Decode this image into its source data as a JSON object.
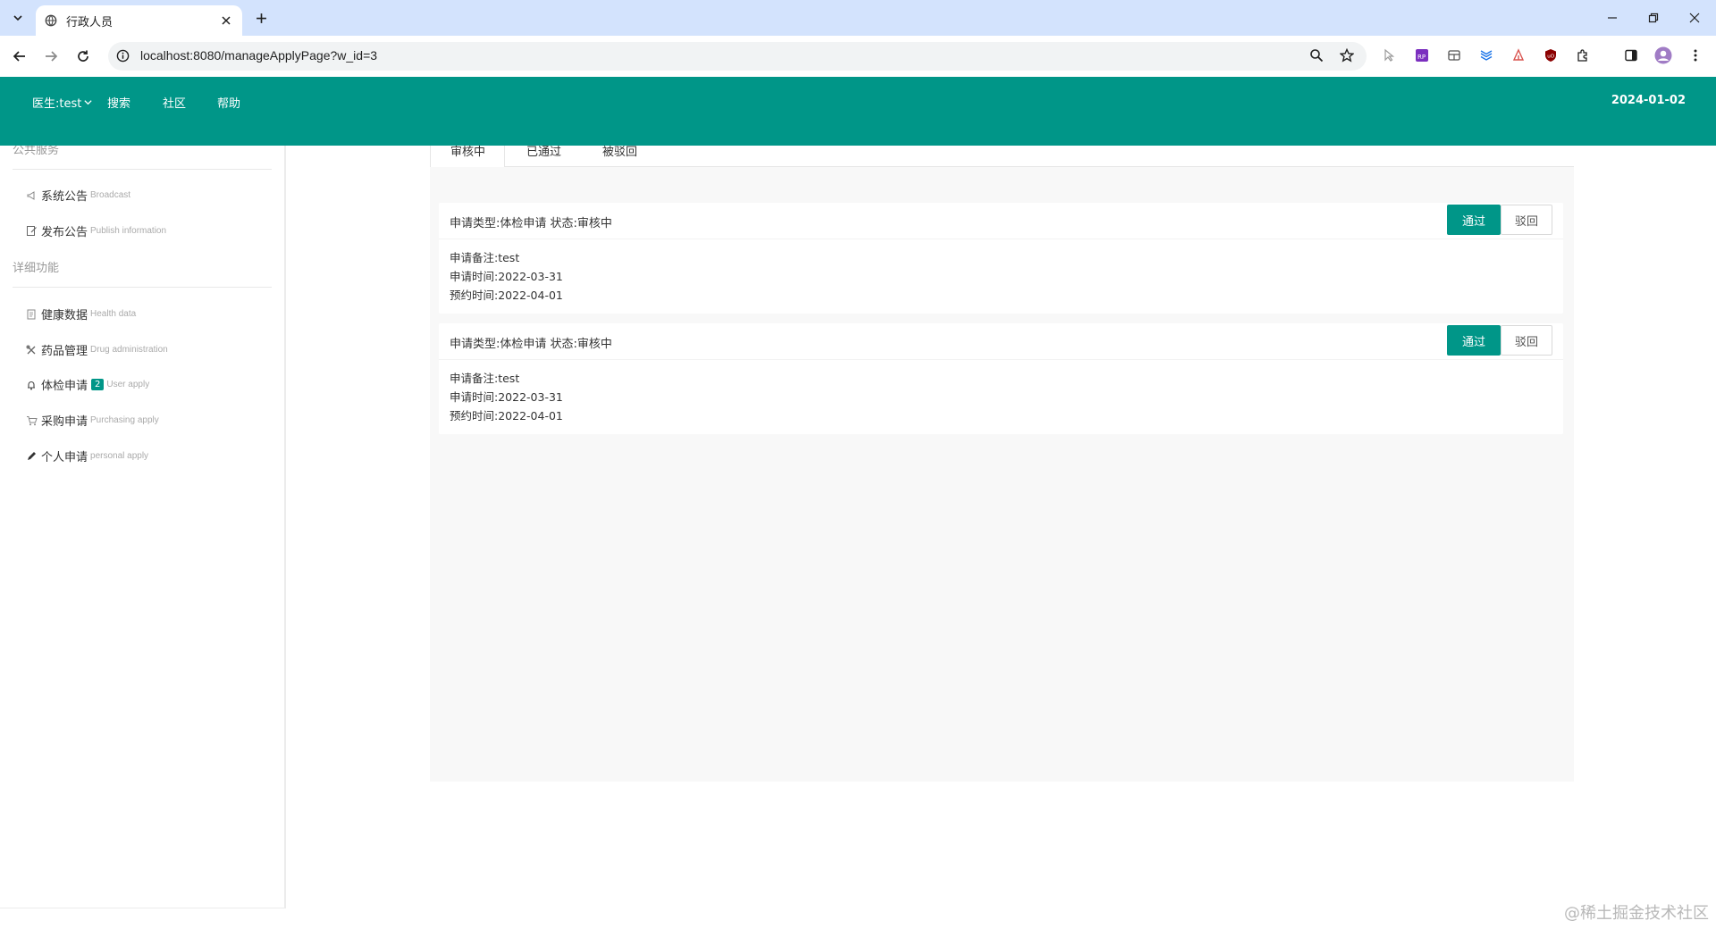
{
  "browser": {
    "tab_title": "行政人员",
    "url": "localhost:8080/manageApplyPage?w_id=3"
  },
  "header": {
    "user_menu": "医生:test",
    "nav": [
      "搜索",
      "社区",
      "帮助"
    ],
    "date": "2024-01-02"
  },
  "sidebar": {
    "section1": "公共服务",
    "section1_items": [
      {
        "label": "系统公告",
        "en": "Broadcast"
      },
      {
        "label": "发布公告",
        "en": "Publish information"
      }
    ],
    "section2": "详细功能",
    "section2_items": [
      {
        "label": "健康数据",
        "en": "Health data"
      },
      {
        "label": "药品管理",
        "en": "Drug administration"
      },
      {
        "label": "体检申请",
        "badge": "2",
        "en": "User apply"
      },
      {
        "label": "采购申请",
        "en": "Purchasing apply"
      },
      {
        "label": "个人申请",
        "en": "personal apply"
      }
    ]
  },
  "tabs": [
    "审核中",
    "已通过",
    "被驳回"
  ],
  "applications": [
    {
      "header": "申请类型:体检申请 状态:审核中",
      "note": "申请备注:test",
      "apply_time": "申请时间:2022-03-31",
      "appoint_time": "预约时间:2022-04-01",
      "pass_label": "通过",
      "reject_label": "驳回"
    },
    {
      "header": "申请类型:体检申请 状态:审核中",
      "note": "申请备注:test",
      "apply_time": "申请时间:2022-03-31",
      "appoint_time": "预约时间:2022-04-01",
      "pass_label": "通过",
      "reject_label": "驳回"
    }
  ],
  "watermark": "@稀土掘金技术社区",
  "colors": {
    "accent": "#009688",
    "tabbar": "#d3e3fd"
  }
}
